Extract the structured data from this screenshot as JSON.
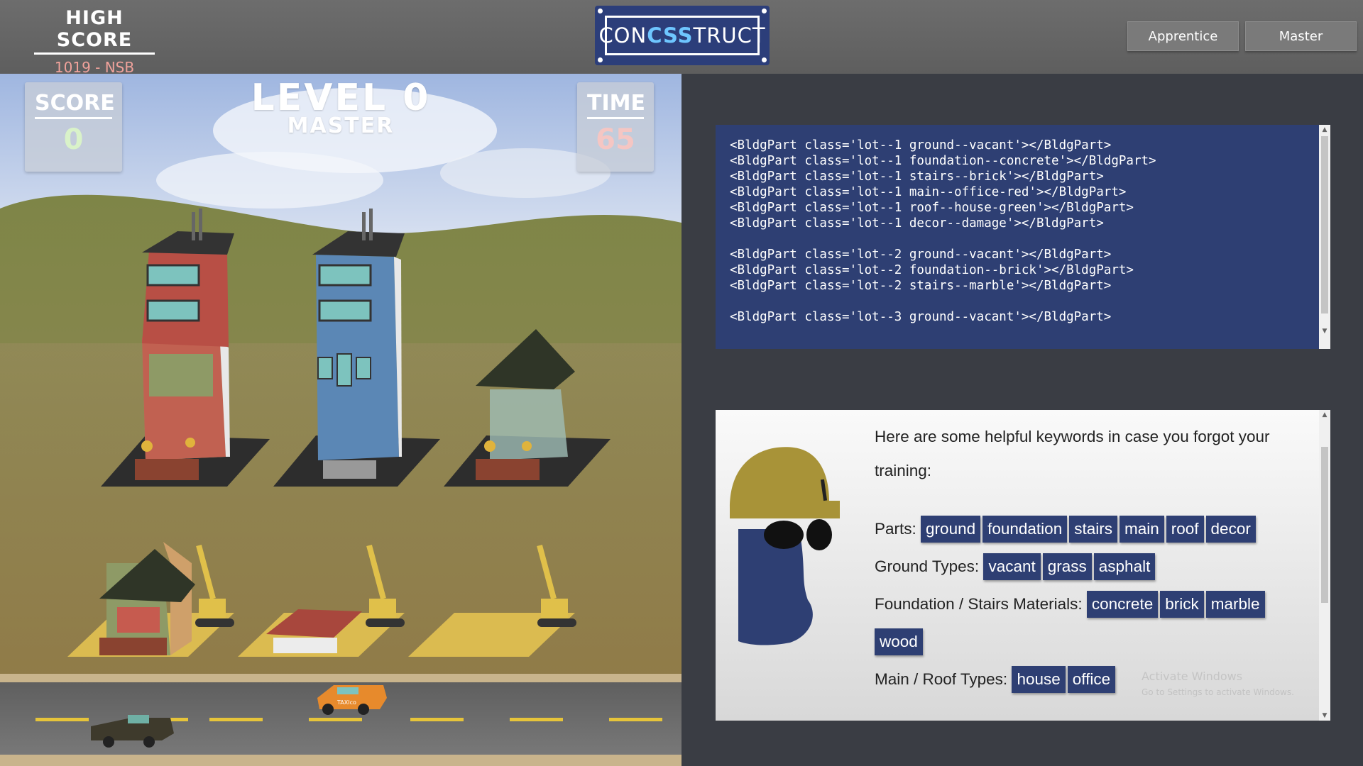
{
  "header": {
    "high_score_label": "HIGH SCORE",
    "high_score_value": "1019 - NSB",
    "logo": {
      "part1": "CON",
      "part2": "CSS",
      "part3": "TRUCT"
    },
    "buttons": {
      "apprentice": "Apprentice",
      "master": "Master"
    }
  },
  "game": {
    "score_label": "SCORE",
    "score_value": "0",
    "level_title": "LEVEL 0",
    "level_mode": "MASTER",
    "time_label": "TIME",
    "time_value": "65",
    "taxi_text": "TAXIco"
  },
  "code": {
    "lines": "<BldgPart class='lot--1 ground--vacant'></BldgPart>\n<BldgPart class='lot--1 foundation--concrete'></BldgPart>\n<BldgPart class='lot--1 stairs--brick'></BldgPart>\n<BldgPart class='lot--1 main--office-red'></BldgPart>\n<BldgPart class='lot--1 roof--house-green'></BldgPart>\n<BldgPart class='lot--1 decor--damage'></BldgPart>\n\n<BldgPart class='lot--2 ground--vacant'></BldgPart>\n<BldgPart class='lot--2 foundation--brick'></BldgPart>\n<BldgPart class='lot--2 stairs--marble'></BldgPart>\n\n<BldgPart class='lot--3 ground--vacant'></BldgPart>"
  },
  "help": {
    "intro": "Here are some helpful keywords in case you forgot your training:",
    "parts_label": "Parts:",
    "parts": [
      "ground",
      "foundation",
      "stairs",
      "main",
      "roof",
      "decor"
    ],
    "ground_label": "Ground Types:",
    "ground": [
      "vacant",
      "grass",
      "asphalt"
    ],
    "materials_label": "Foundation / Stairs Materials:",
    "materials": [
      "concrete",
      "brick",
      "marble",
      "wood"
    ],
    "mainroof_label": "Main / Roof Types:",
    "mainroof": [
      "house",
      "office"
    ],
    "watermark_line1": "Activate Windows",
    "watermark_line2": "Go to Settings to activate Windows."
  },
  "colors": {
    "navy": "#2e3f73",
    "score_green": "#d9f2c9",
    "time_pink": "#f5c6c3",
    "high_score_value": "#f0a29b"
  }
}
